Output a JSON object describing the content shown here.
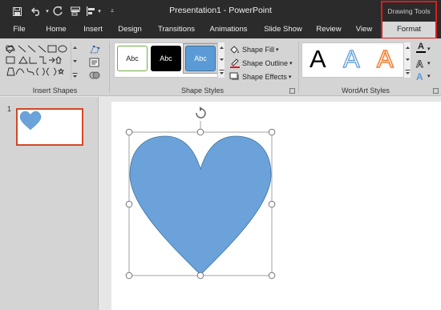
{
  "titlebar": {
    "title": "Presentation1 - PowerPoint",
    "contextual_group": "Drawing Tools",
    "quick_access": [
      "save-icon",
      "undo-icon",
      "redo-icon",
      "touch-mode-icon",
      "align-icon",
      "customize-icon"
    ]
  },
  "tabs": [
    "File",
    "Home",
    "Insert",
    "Design",
    "Transitions",
    "Animations",
    "Slide Show",
    "Review",
    "View",
    "Format"
  ],
  "ribbon": {
    "insert_shapes_label": "Insert Shapes",
    "shape_styles_label": "Shape Styles",
    "wordart_styles_label": "WordArt Styles",
    "style_samples": [
      "Abc",
      "Abc",
      "Abc"
    ],
    "shape_fill": "Shape Fill",
    "shape_outline": "Shape Outline",
    "shape_effects": "Shape Effects",
    "wordart_samples": [
      "A",
      "A",
      "A"
    ],
    "text_fill_letter": "A",
    "text_outline_letter": "A",
    "text_effects_letter": "A"
  },
  "thumbnail": {
    "slide_number": "1"
  },
  "colors": {
    "heart_fill": "#6aa2d9",
    "accent_red": "#e11a1a",
    "thumb_border": "#d24726",
    "selected_style": "#5b9bd5"
  }
}
